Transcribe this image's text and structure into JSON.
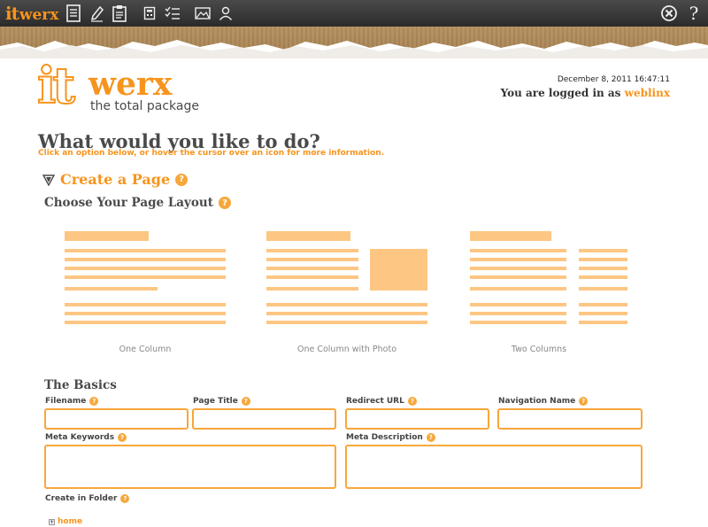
{
  "app": {
    "logo_it": "it",
    "logo_werx": "werx",
    "tagline": "the total package"
  },
  "toolbar": {
    "icons": [
      "pages-icon",
      "edit-icon",
      "clipboard-icon",
      "calculator-icon",
      "checklist-icon",
      "image-icon",
      "user-icon"
    ],
    "right_icons": [
      "logout-icon",
      "help-icon"
    ],
    "help_glyph": "?"
  },
  "session": {
    "datetime": "December 8, 2011 16:47:11",
    "logged_in_prefix": "You are logged in as",
    "username": "weblinx"
  },
  "main": {
    "heading": "What would you like to do?",
    "subheading": "Click an option below, or hover the cursor over an icon for more information.",
    "create_title": "Create a Page",
    "layout_title": "Choose Your Page Layout",
    "help_glyph": "?"
  },
  "layouts": [
    {
      "label": "One Column"
    },
    {
      "label": "One Column with Photo"
    },
    {
      "label": "Two Columns"
    }
  ],
  "basics": {
    "title": "The Basics",
    "filename_label": "Filename",
    "page_title_label": "Page Title",
    "redirect_url_label": "Redirect URL",
    "navigation_name_label": "Navigation Name",
    "meta_keywords_label": "Meta Keywords",
    "meta_description_label": "Meta Description",
    "create_in_folder_label": "Create in Folder",
    "filename_value": "",
    "page_title_value": "",
    "redirect_url_value": "",
    "navigation_name_value": "",
    "meta_keywords_value": "",
    "meta_description_value": ""
  },
  "folder_tree": {
    "expand_glyph": "+",
    "root": "home"
  },
  "colors": {
    "accent": "#f7941d",
    "layout_bar": "#fdc683",
    "toolbar": "#333333"
  }
}
